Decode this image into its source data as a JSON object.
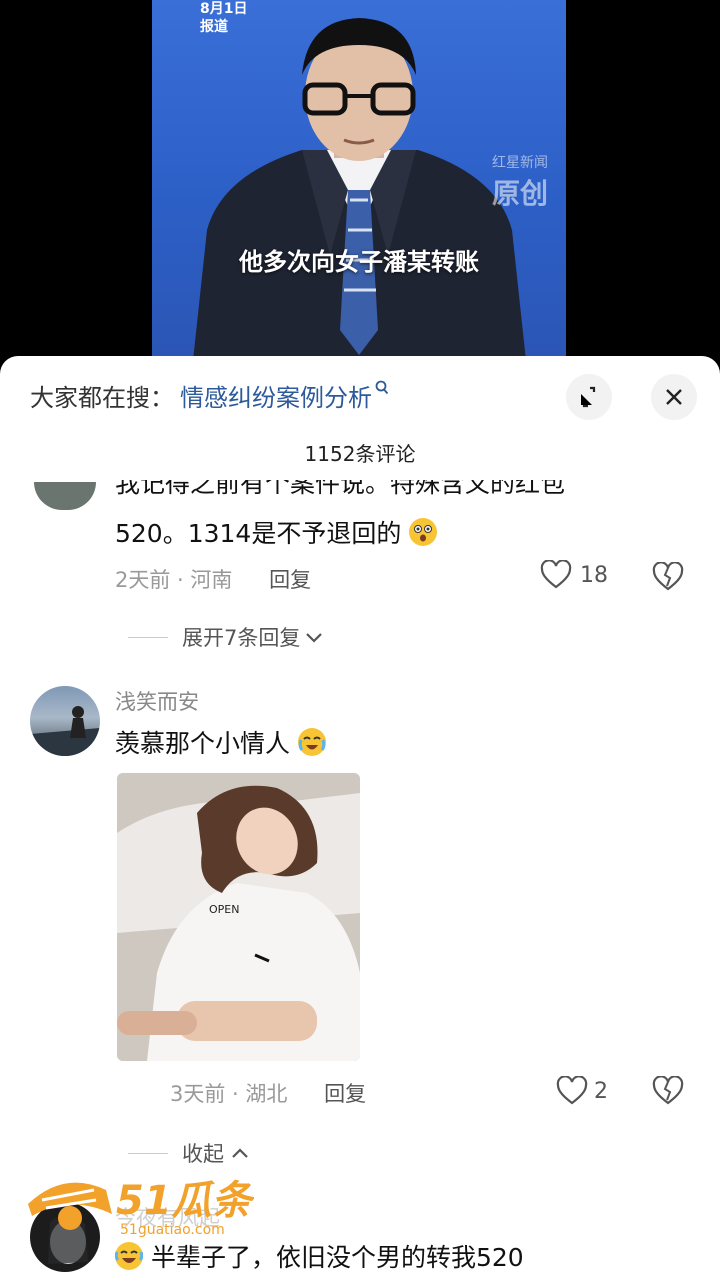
{
  "video": {
    "date_line1": "8月1日",
    "date_line2": "报道",
    "watermark_line1": "红星新闻",
    "watermark_line2": "原创",
    "subtitle": "他多次向女子潘某转账"
  },
  "comments_panel": {
    "search_prefix": "大家都在搜：",
    "search_keyword": "情感纠纷案例分析",
    "comment_count": "1152条评论",
    "comments": [
      {
        "text_line1": "我记得之前有个案件说。特殊含义的红包",
        "text_line2": "520。1314是不予退回的",
        "time_location": "2天前 · 河南",
        "reply_label": "回复",
        "likes": "18",
        "expand_label": "展开7条回复"
      },
      {
        "username": "浅笑而安",
        "text": "羡慕那个小情人",
        "time_location": "3天前 · 湖北",
        "reply_label": "回复",
        "likes": "2",
        "collapse_label": "收起"
      },
      {
        "username": "今夜有风起",
        "text": "半辈子了，依旧没个男的转我520"
      }
    ]
  },
  "photo_print": "OPEN",
  "watermark_logo": {
    "brand": "51瓜条",
    "url": "51guatiao.com"
  }
}
